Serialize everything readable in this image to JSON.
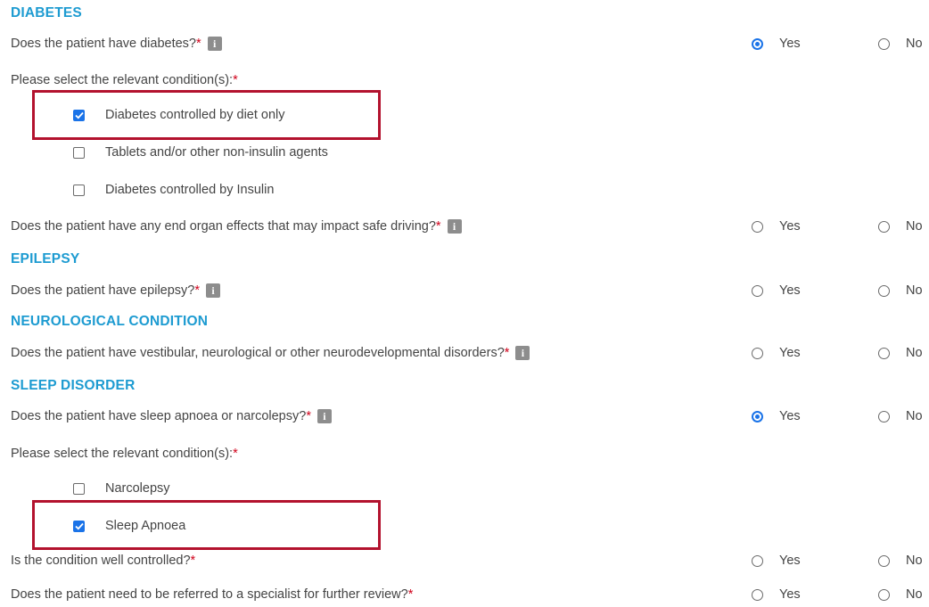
{
  "sections": {
    "diabetes": {
      "title": "DIABETES",
      "q1": {
        "text": "Does the patient have diabetes?",
        "answer": "yes"
      },
      "select_label": "Please select the relevant condition(s): ",
      "options": [
        {
          "label": "Diabetes controlled by diet only",
          "checked": true
        },
        {
          "label": "Tablets and/or other non-insulin agents",
          "checked": false
        },
        {
          "label": "Diabetes controlled by Insulin",
          "checked": false
        }
      ],
      "q2": {
        "text": "Does the patient have any end organ effects that may impact safe driving?",
        "answer": null
      }
    },
    "epilepsy": {
      "title": "EPILEPSY",
      "q1": {
        "text": "Does the patient have epilepsy?",
        "answer": null
      }
    },
    "neuro": {
      "title": "NEUROLOGICAL CONDITION",
      "q1": {
        "text": "Does the patient have vestibular, neurological or other neurodevelopmental disorders?",
        "answer": null
      }
    },
    "sleep": {
      "title": "SLEEP DISORDER",
      "q1": {
        "text": "Does the patient have sleep apnoea or narcolepsy?",
        "answer": "yes"
      },
      "select_label": "Please select the relevant condition(s): ",
      "options": [
        {
          "label": "Narcolepsy",
          "checked": false
        },
        {
          "label": "Sleep Apnoea",
          "checked": true
        }
      ],
      "q2": {
        "text": "Is the condition well controlled?",
        "answer": null
      },
      "q3": {
        "text": "Does the patient need to be referred to a specialist for further review?",
        "answer": null
      }
    }
  },
  "labels": {
    "yes": "Yes",
    "no": "No",
    "required": "*",
    "info": "i"
  },
  "colors": {
    "accent": "#1a73e8",
    "section_title": "#1d9bd1",
    "highlight": "#b3122e",
    "required": "#d0021b"
  },
  "icons": {
    "info": "info-icon",
    "check": "checkmark-icon"
  }
}
